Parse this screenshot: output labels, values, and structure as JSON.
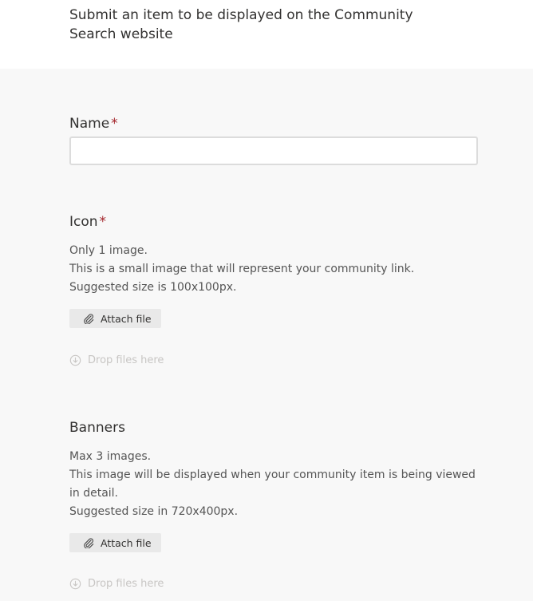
{
  "header": {
    "title": "Submit an item to be displayed on the Community Search website"
  },
  "form": {
    "name": {
      "label": "Name",
      "required_mark": "*",
      "value": ""
    },
    "icon": {
      "label": "Icon",
      "required_mark": "*",
      "description": [
        "Only 1 image.",
        "This is a small image that will represent your community link.",
        "Suggested size is 100x100px."
      ],
      "attach_label": "Attach file",
      "drop_label": "Drop files here"
    },
    "banners": {
      "label": "Banners",
      "description": [
        "Max 3 images.",
        "This image will be displayed when your community item is being viewed in detail.",
        "Suggested size in 720x400px."
      ],
      "attach_label": "Attach file",
      "drop_label": "Drop files here"
    }
  },
  "colors": {
    "required": "#a4262c",
    "background": "#f8f8f8",
    "header_background": "#ffffff",
    "button_background": "#e9e9e9",
    "muted": "#c8c6c4"
  },
  "icons": {
    "attach": "paperclip-icon",
    "drop": "download-circle-icon"
  }
}
